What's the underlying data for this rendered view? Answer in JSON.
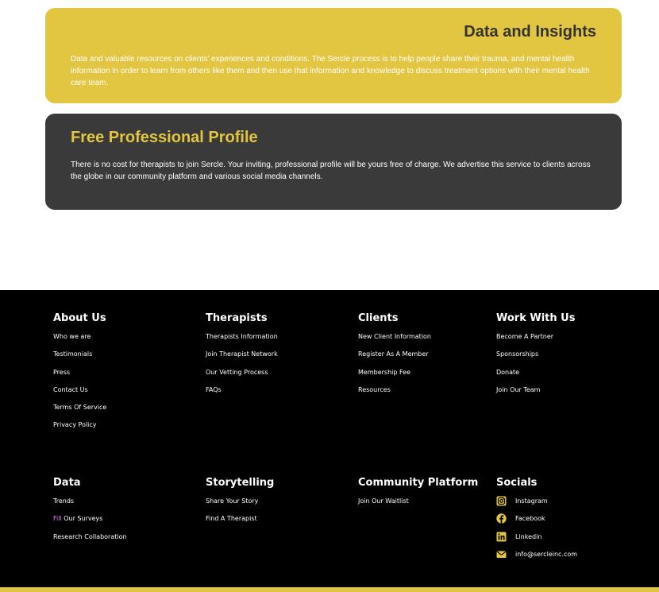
{
  "cards": {
    "data_insights": {
      "title": "Data and Insights",
      "body": "Data and valuable resources on clients' experiences and conditions. The Sercle process is to help people share their trauma, and mental health information in order to learn from others like them and then use that information and knowledge to discuss treatment options with their mental health care team."
    },
    "free_profile": {
      "title": "Free Professional Profile",
      "body": "There is no cost for therapists to join Sercle. Your inviting, professional profile will be yours free of charge. We advertise this service to clients across the globe in our community platform and various social media channels."
    }
  },
  "footer": {
    "about": {
      "heading": "About Us",
      "links": [
        "Who we are",
        "Testimonials",
        "Press",
        "Contact Us",
        "Terms Of Service",
        "Privacy Policy"
      ]
    },
    "therapists": {
      "heading": "Therapists",
      "links": [
        "Therapists Information",
        "Join Therapist Network",
        "Our Vetting Process",
        "FAQs"
      ]
    },
    "clients": {
      "heading": "Clients",
      "links": [
        "New Client Information",
        "Register As A Member",
        "Membership Fee",
        "Resources"
      ]
    },
    "work": {
      "heading": "Work With Us",
      "links": [
        "Become A Partner",
        "Sponsorships",
        "Donate",
        "Join Our Team"
      ]
    },
    "data": {
      "heading": "Data",
      "links": [
        "Trends",
        "Our Surveys",
        "Research Collaboration"
      ],
      "fill_prefix": "Fill"
    },
    "storytelling": {
      "heading": "Storytelling",
      "links": [
        "Share Your Story",
        "Find A Therapist"
      ]
    },
    "community": {
      "heading": "Community Platform",
      "links": [
        "Join Our Waitlist"
      ]
    },
    "socials": {
      "heading": "Socials",
      "items": [
        {
          "icon": "instagram-icon",
          "label": "Instagram"
        },
        {
          "icon": "facebook-icon",
          "label": "Facebook"
        },
        {
          "icon": "linkedin-icon",
          "label": "Linkedin"
        },
        {
          "icon": "email-icon",
          "label": "info@sercleinc.com"
        }
      ]
    }
  },
  "colors": {
    "accent_yellow": "#e2c540",
    "dark_card": "#3a3a3a",
    "footer_bg": "#000000"
  }
}
